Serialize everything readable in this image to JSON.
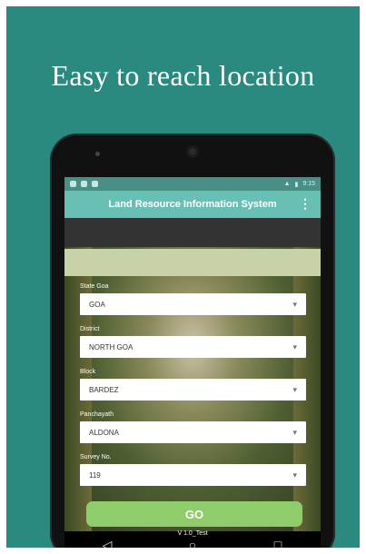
{
  "headline": "Easy to reach location",
  "status_bar": {
    "time": "9:15"
  },
  "app_bar": {
    "title": "Land Resource Information System",
    "menu_icon": "more-vert-icon"
  },
  "banner": {
    "text": ""
  },
  "fields": [
    {
      "label": "State Goa",
      "value": "GOA"
    },
    {
      "label": "District",
      "value": "NORTH GOA"
    },
    {
      "label": "Block",
      "value": "BARDEZ"
    },
    {
      "label": "Panchayath",
      "value": "ALDONA"
    },
    {
      "label": "Survey No.",
      "value": "119"
    }
  ],
  "go_button": {
    "label": "GO"
  },
  "version": "V 1.0_Test",
  "nav": {
    "back_icon": "◁",
    "home_icon": "○",
    "recents_icon": "□"
  },
  "colors": {
    "background": "#2a8a80",
    "appbar": "#68c0b4",
    "go_button": "#8fcc6a"
  }
}
